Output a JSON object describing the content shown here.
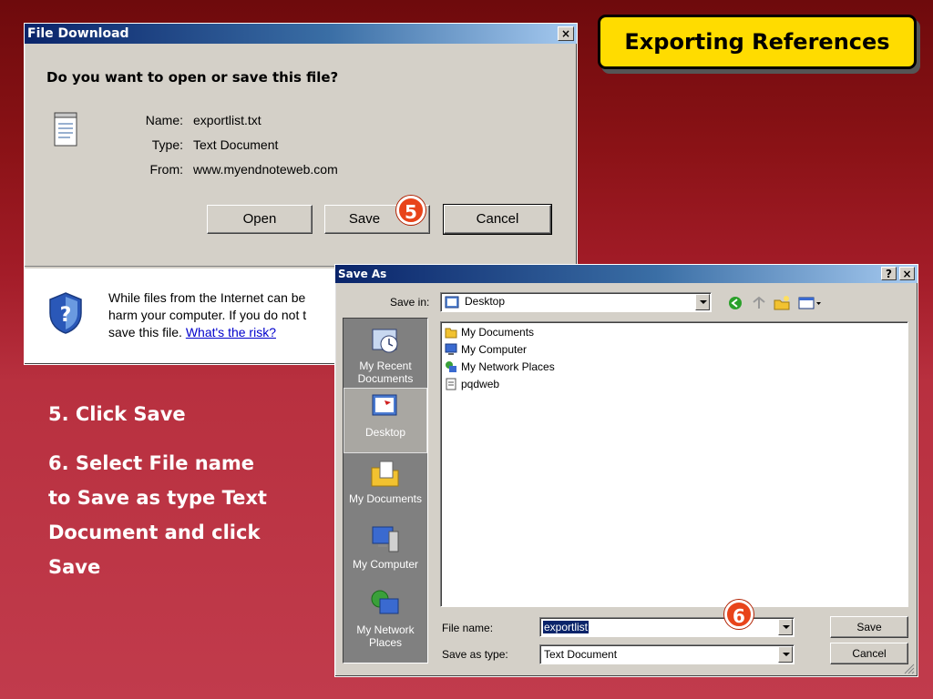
{
  "slide_title": "Exporting References",
  "file_download": {
    "title": "File Download",
    "close_glyph": "×",
    "question": "Do you want to open or save this file?",
    "name_label": "Name:",
    "name_value": "exportlist.txt",
    "type_label": "Type:",
    "type_value": "Text Document",
    "from_label": "From:",
    "from_value": "www.myendnoteweb.com",
    "open_label": "Open",
    "save_label": "Save",
    "cancel_label": "Cancel",
    "warning_line1": "While files from the Internet can be",
    "warning_line2": "harm your computer. If you do not t",
    "warning_line3": "save this file.",
    "risk_link": "What's the risk?"
  },
  "badges": {
    "step5": "5",
    "step6": "6"
  },
  "instructions": {
    "step5": "5. Click Save",
    "step6_line1": "6. Select File name",
    "step6_line2": "to Save as type Text",
    "step6_line3": "Document and click",
    "step6_line4": "Save"
  },
  "save_as": {
    "title": "Save As",
    "help_glyph": "?",
    "close_glyph": "×",
    "save_in_label": "Save in:",
    "save_in_value": "Desktop",
    "places": [
      {
        "label_line1": "My Recent",
        "label_line2": "Documents"
      },
      {
        "label_line1": "Desktop",
        "label_line2": ""
      },
      {
        "label_line1": "My Documents",
        "label_line2": ""
      },
      {
        "label_line1": "My Computer",
        "label_line2": ""
      },
      {
        "label_line1": "My Network",
        "label_line2": "Places"
      }
    ],
    "files": [
      "My Documents",
      "My Computer",
      "My Network Places",
      "pqdweb"
    ],
    "file_name_label": "File name:",
    "file_name_value": "exportlist",
    "save_type_label": "Save as type:",
    "save_type_value": "Text Document",
    "save_label": "Save",
    "cancel_label": "Cancel"
  },
  "colors": {
    "badge": "#e8441a",
    "title_badge": "#ffdc00",
    "titlebar": "#0a246a",
    "background": "#a31c28"
  }
}
